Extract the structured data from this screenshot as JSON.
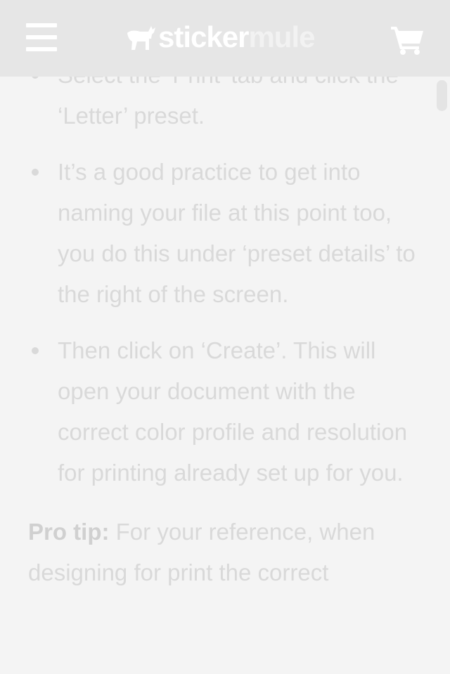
{
  "header": {
    "menu_icon": "hamburger-menu-icon",
    "logo": {
      "icon": "mule-icon",
      "part1": "sticker",
      "part2": "mule"
    },
    "cart_icon": "shopping-cart-icon"
  },
  "article": {
    "bullets": [
      "Select the ‘Print’ tab and click the ‘Letter’ preset.",
      "It’s a good practice to get into naming your file at this point too, you do this under ‘preset details’ to the right of the screen.",
      "Then click on ‘Create’. This will open your document with the correct color profile and resolution for printing already set up for you."
    ],
    "pro_tip": {
      "label": "Pro tip:",
      "text": " For your reference, when designing for print the correct"
    }
  },
  "colors": {
    "header_bg": "#e6e6e6",
    "page_bg": "#f4f4f4",
    "text": "#d9d9d9",
    "logo_primary": "#ffffff"
  }
}
